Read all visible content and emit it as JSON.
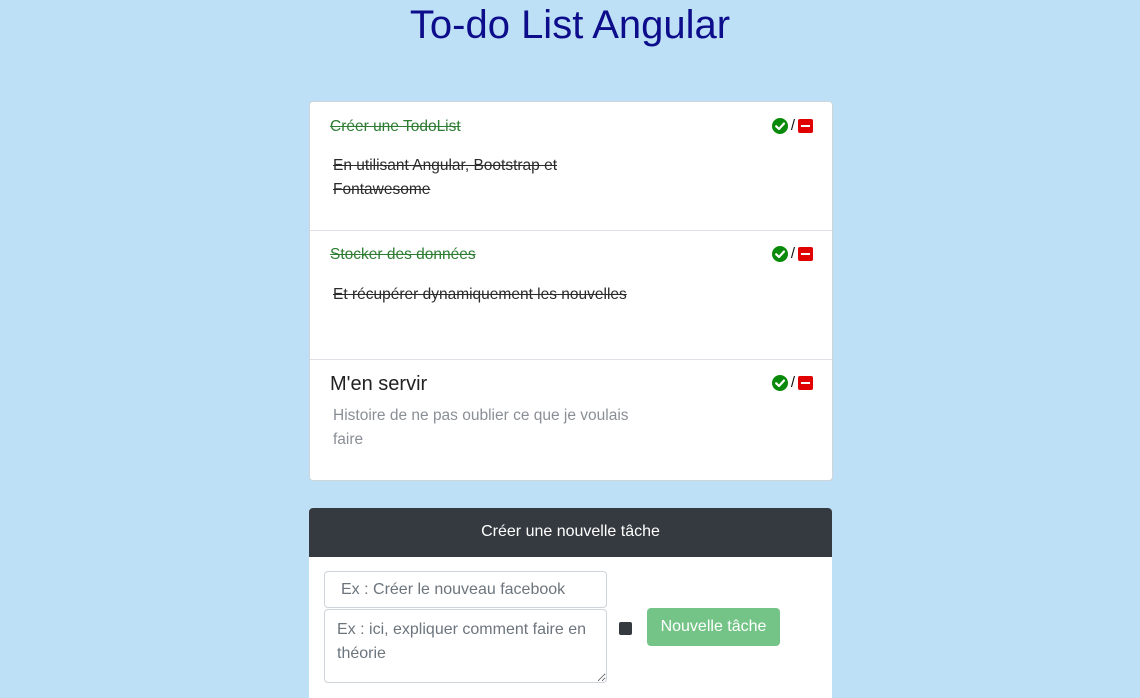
{
  "page": {
    "title": "To-do List Angular"
  },
  "todos": [
    {
      "title": "Créer une TodoList",
      "description": "En utilisant Angular, Bootstrap et Fontawesome",
      "done": true
    },
    {
      "title": "Stocker des données",
      "description": "Et récupérer dynamiquement les nouvelles",
      "done": true
    },
    {
      "title": "M'en servir",
      "description": "Histoire de ne pas oublier ce que je voulais faire",
      "done": false
    }
  ],
  "actions": {
    "separator": "/",
    "check_icon": "check-circle-icon",
    "delete_icon": "minus-square-icon",
    "check_color": "#0a8a0a",
    "delete_color": "#e00000"
  },
  "new_task": {
    "header": "Créer une nouvelle tâche",
    "title_placeholder": "Ex : Créer le nouveau facebook",
    "description_placeholder": "Ex : ici, expliquer comment faire en théorie",
    "button_label": "Nouvelle tâche",
    "button_color": "#74c487"
  }
}
